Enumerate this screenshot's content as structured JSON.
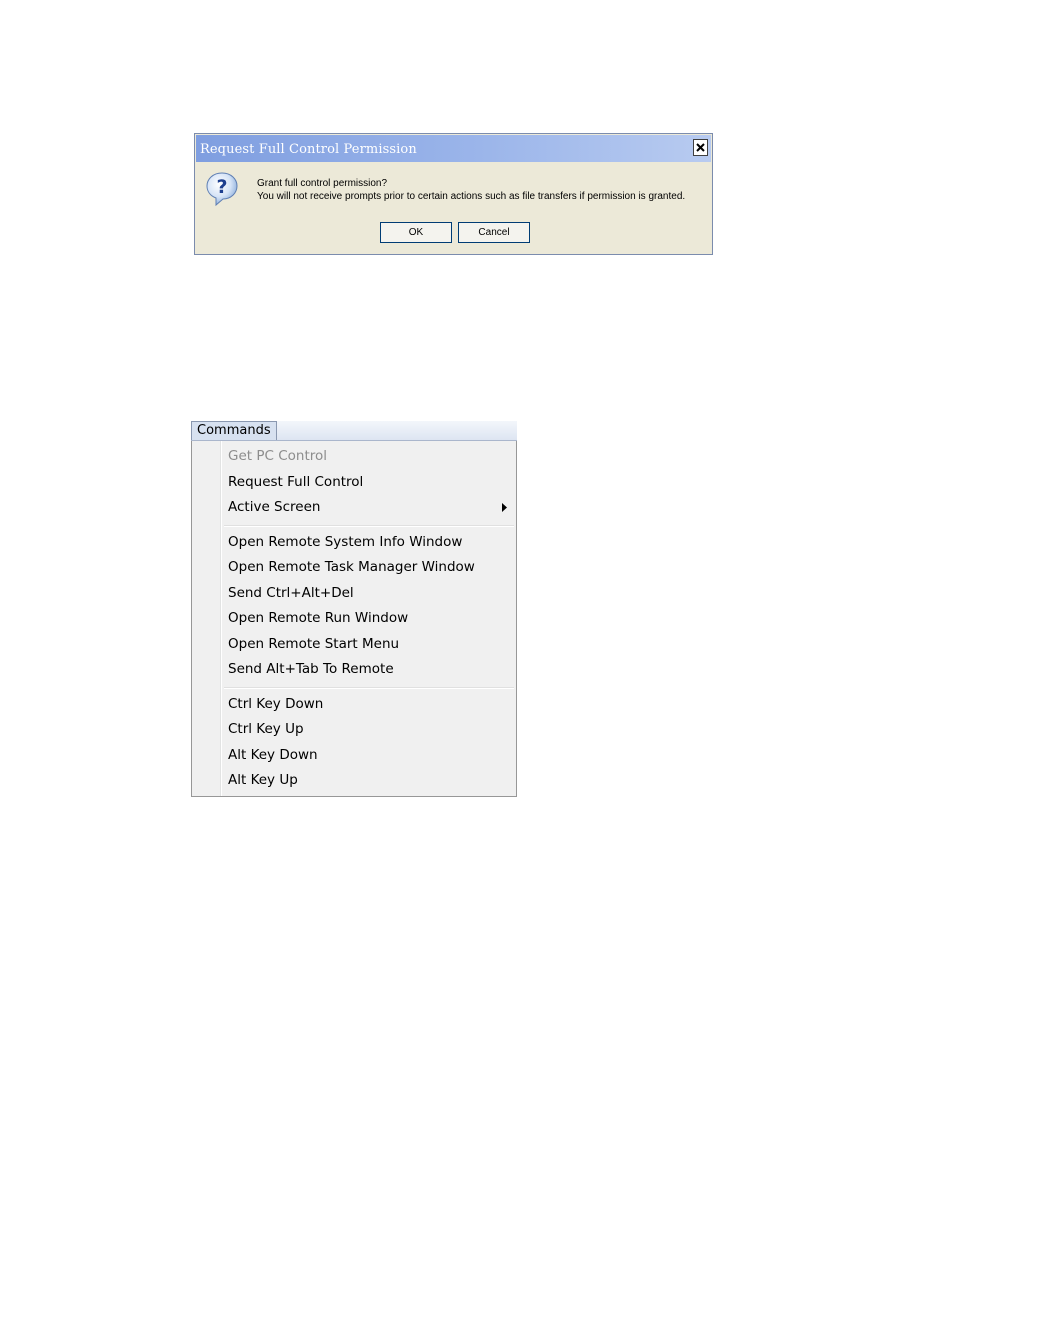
{
  "dialog": {
    "title": "Request Full Control Permission",
    "icon": "question-icon",
    "message_line1": "Grant full control permission?",
    "message_line2": "You will not receive prompts prior to certain actions such as file transfers if permission is granted.",
    "ok_label": "OK",
    "cancel_label": "Cancel"
  },
  "menubar": {
    "label": "Commands"
  },
  "menu": {
    "items": [
      {
        "label": "Get PC Control",
        "disabled": true
      },
      {
        "label": "Request Full Control"
      },
      {
        "label": "Active Screen",
        "submenu": true
      },
      {
        "label": "Open Remote System Info Window"
      },
      {
        "label": "Open Remote Task Manager Window"
      },
      {
        "label": "Send Ctrl+Alt+Del"
      },
      {
        "label": "Open Remote Run Window"
      },
      {
        "label": "Open Remote Start Menu"
      },
      {
        "label": "Send Alt+Tab To Remote"
      },
      {
        "label": "Ctrl Key Down"
      },
      {
        "label": "Ctrl Key Up"
      },
      {
        "label": "Alt Key Down"
      },
      {
        "label": "Alt Key Up"
      }
    ]
  }
}
